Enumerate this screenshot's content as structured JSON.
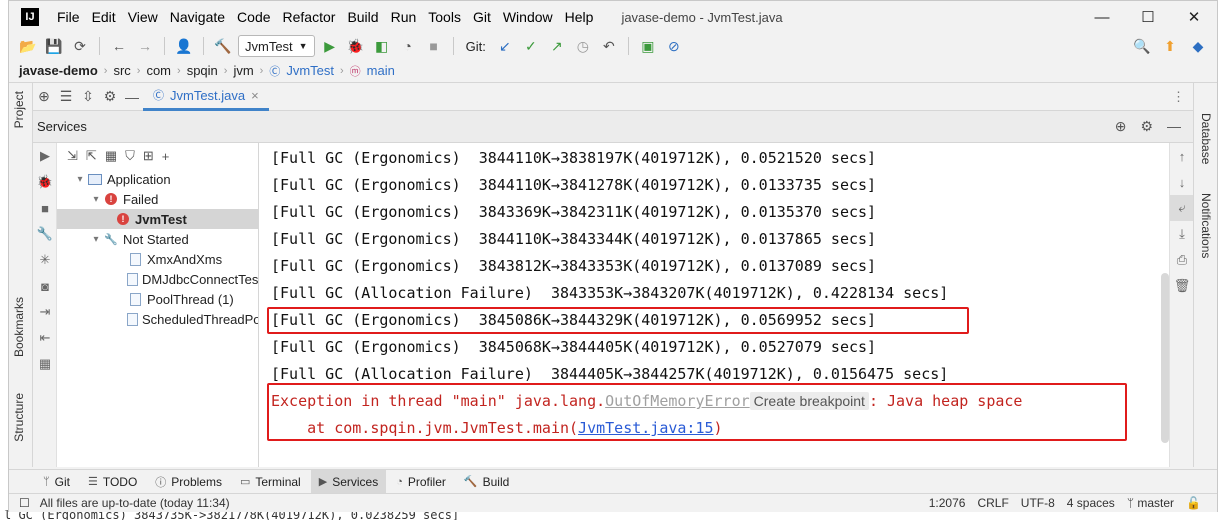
{
  "window": {
    "title": "javase-demo - JvmTest.java",
    "minimize": "—",
    "maximize": "☐",
    "close": "✕"
  },
  "menu": [
    "File",
    "Edit",
    "View",
    "Navigate",
    "Code",
    "Refactor",
    "Build",
    "Run",
    "Tools",
    "Git",
    "Window",
    "Help"
  ],
  "toolbar": {
    "run_config": "JvmTest",
    "git_label": "Git:"
  },
  "breadcrumb": {
    "root": "javase-demo",
    "parts": [
      "src",
      "com",
      "spqin",
      "jvm"
    ],
    "class": "JvmTest",
    "method": "main"
  },
  "left_stripe": {
    "project": "Project",
    "bookmarks": "Bookmarks",
    "structure": "Structure"
  },
  "right_stripe": {
    "database": "Database",
    "notifications": "Notifications"
  },
  "editor_tab": {
    "label": "JvmTest.java",
    "close": "×"
  },
  "services": {
    "title": "Services"
  },
  "tree": {
    "application": "Application",
    "failed": "Failed",
    "jvmtest": "JvmTest",
    "not_started": "Not Started",
    "items": [
      "XmxAndXms",
      "DMJdbcConnectTest",
      "PoolThread (1)",
      "ScheduledThreadPoo"
    ]
  },
  "console": {
    "lines": [
      "[Full GC (Ergonomics)  3844110K->3838197K(4019712K), 0.0521520 secs]",
      "[Full GC (Ergonomics)  3844110K->3841278K(4019712K), 0.0133735 secs]",
      "[Full GC (Ergonomics)  3843369K->3842311K(4019712K), 0.0135370 secs]",
      "[Full GC (Ergonomics)  3844110K->3843344K(4019712K), 0.0137865 secs]",
      "[Full GC (Ergonomics)  3843812K->3843353K(4019712K), 0.0137089 secs]",
      "[Full GC (Allocation Failure)  3843353K->3843207K(4019712K), 0.4228134 secs]",
      "[Full GC (Ergonomics)  3845086K->3844329K(4019712K), 0.0569952 secs]",
      "[Full GC (Ergonomics)  3845068K->3844405K(4019712K), 0.0527079 secs]",
      "[Full GC (Allocation Failure)  3844405K->3844257K(4019712K), 0.0156475 secs]"
    ],
    "exception_prefix": "Exception in thread \"main\" java.lang.",
    "exception_class": "OutOfMemoryError",
    "create_breakpoint": "Create breakpoint",
    "exception_suffix": ": Java heap space",
    "stack_prefix": "    at com.spqin.jvm.JvmTest.main(",
    "stack_link": "JvmTest.java:15",
    "stack_suffix": ")"
  },
  "tool_tabs": [
    "Git",
    "TODO",
    "Problems",
    "Terminal",
    "Services",
    "Profiler",
    "Build"
  ],
  "status": {
    "message": "All files are up-to-date (today 11:34)",
    "position": "1:2076",
    "line_sep": "CRLF",
    "encoding": "UTF-8",
    "indent": "4 spaces",
    "branch": "master"
  },
  "background": {
    "bottom_text": "l GC (Ergonomics)  3843735K->3821778K(4019712K), 0.0238259 secs]"
  },
  "colors": {
    "accent": "#4083c9",
    "error": "#c2241f",
    "highlight_box": "#e01b1b",
    "run_green": "#3c9a3c"
  }
}
